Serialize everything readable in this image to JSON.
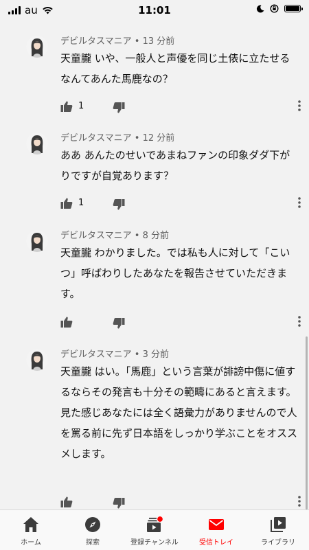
{
  "status_bar": {
    "carrier": "au",
    "time": "11:01"
  },
  "comments": [
    {
      "author": "デビルタスマニア",
      "time": "13 分前",
      "paragraphs": [
        "天童朧 いや、一般人と声優を同じ土俵に立たせるなんてあんた馬鹿なの？"
      ],
      "like_count": "1"
    },
    {
      "author": "デビルタスマニア",
      "time": "12 分前",
      "paragraphs": [
        "ああ あんたのせいであまねファンの印象ダダ下がりですが自覚あります？"
      ],
      "like_count": "1"
    },
    {
      "author": "デビルタスマニア",
      "time": "8 分前",
      "paragraphs": [
        "天童朧 わかりました。では私も人に対して「こいつ」呼ばわりしたあなたを報告させていただきます。"
      ],
      "like_count": ""
    },
    {
      "author": "デビルタスマニア",
      "time": "3 分前",
      "paragraphs": [
        "天童朧 はい。「馬鹿」という言葉が誹謗中傷に値するならその発言も十分その範疇にあると言えます。",
        "見た感じあなたには全く語彙力がありませんので人を罵る前に先ず日本語をしっかり学ぶことをオススメします。"
      ],
      "like_count": ""
    }
  ],
  "meta_separator": "•",
  "bottom_nav": {
    "items": [
      {
        "label": "ホーム",
        "icon": "home-icon"
      },
      {
        "label": "探索",
        "icon": "explore-icon"
      },
      {
        "label": "登録チャンネル",
        "icon": "subscriptions-icon"
      },
      {
        "label": "受信トレイ",
        "icon": "inbox-icon"
      },
      {
        "label": "ライブラリ",
        "icon": "library-icon"
      }
    ],
    "active_color": "#ff0000"
  }
}
